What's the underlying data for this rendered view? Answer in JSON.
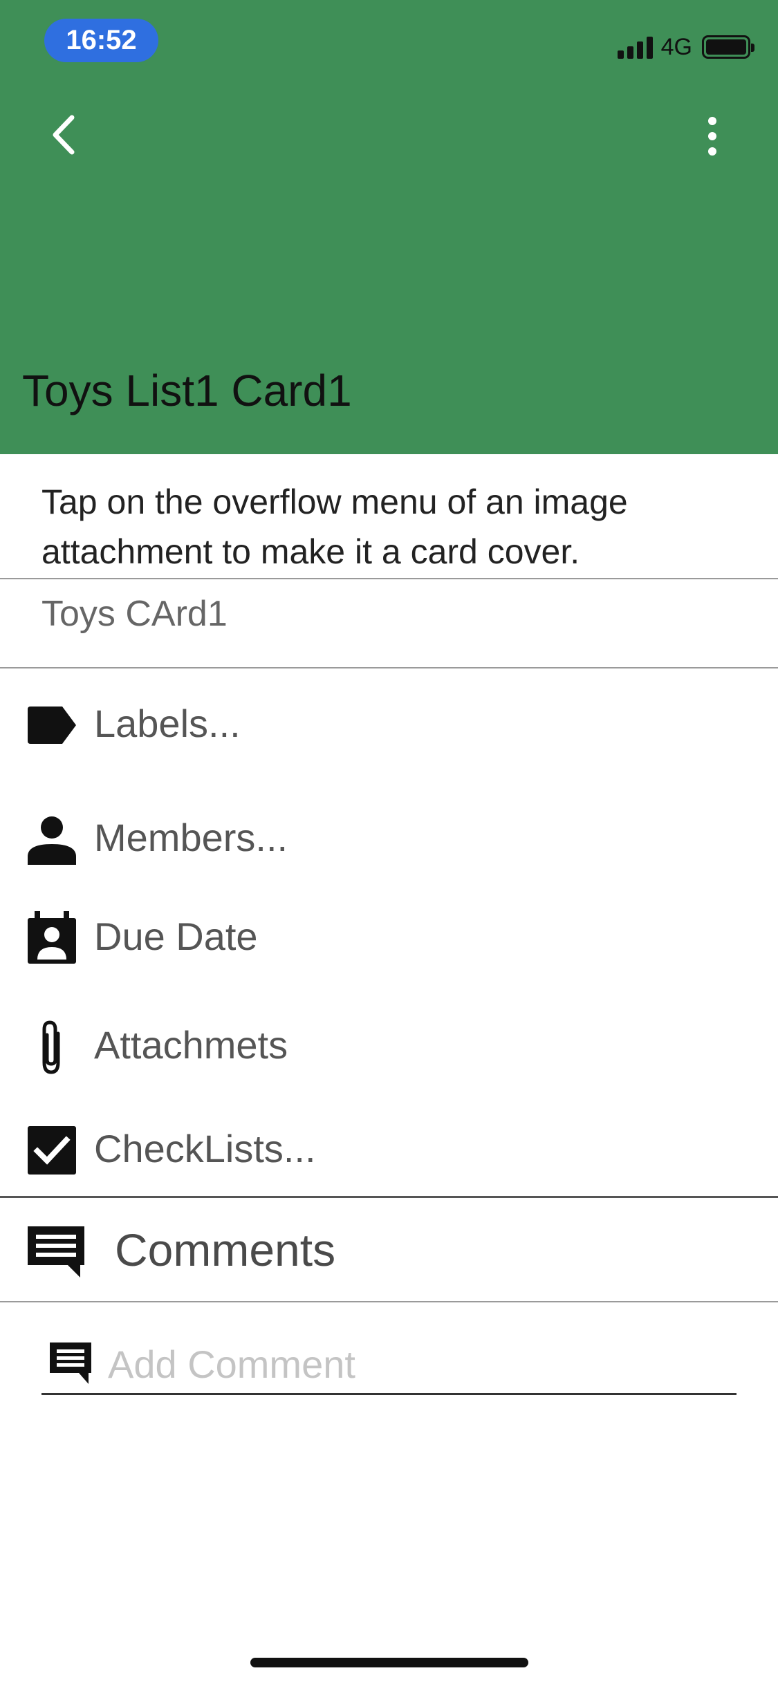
{
  "status_bar": {
    "time": "16:52",
    "network": "4G"
  },
  "header": {
    "back_icon": "chevron-left-icon",
    "overflow_icon": "more-vertical-icon",
    "title": "Toys List1 Card1",
    "background_color": "#3f8f57"
  },
  "description": {
    "hint": "Tap on the overflow menu of an image attachment to make it a card cover.",
    "value": "Toys CArd1"
  },
  "menu": {
    "items": [
      {
        "icon": "label-icon",
        "label": "Labels..."
      },
      {
        "icon": "person-icon",
        "label": "Members..."
      },
      {
        "icon": "calendar-icon",
        "label": "Due Date"
      },
      {
        "icon": "paperclip-icon",
        "label": "Attachmets"
      },
      {
        "icon": "checkbox-icon",
        "label": "CheckLists..."
      }
    ]
  },
  "comments": {
    "title": "Comments",
    "input_placeholder": "Add Comment"
  }
}
